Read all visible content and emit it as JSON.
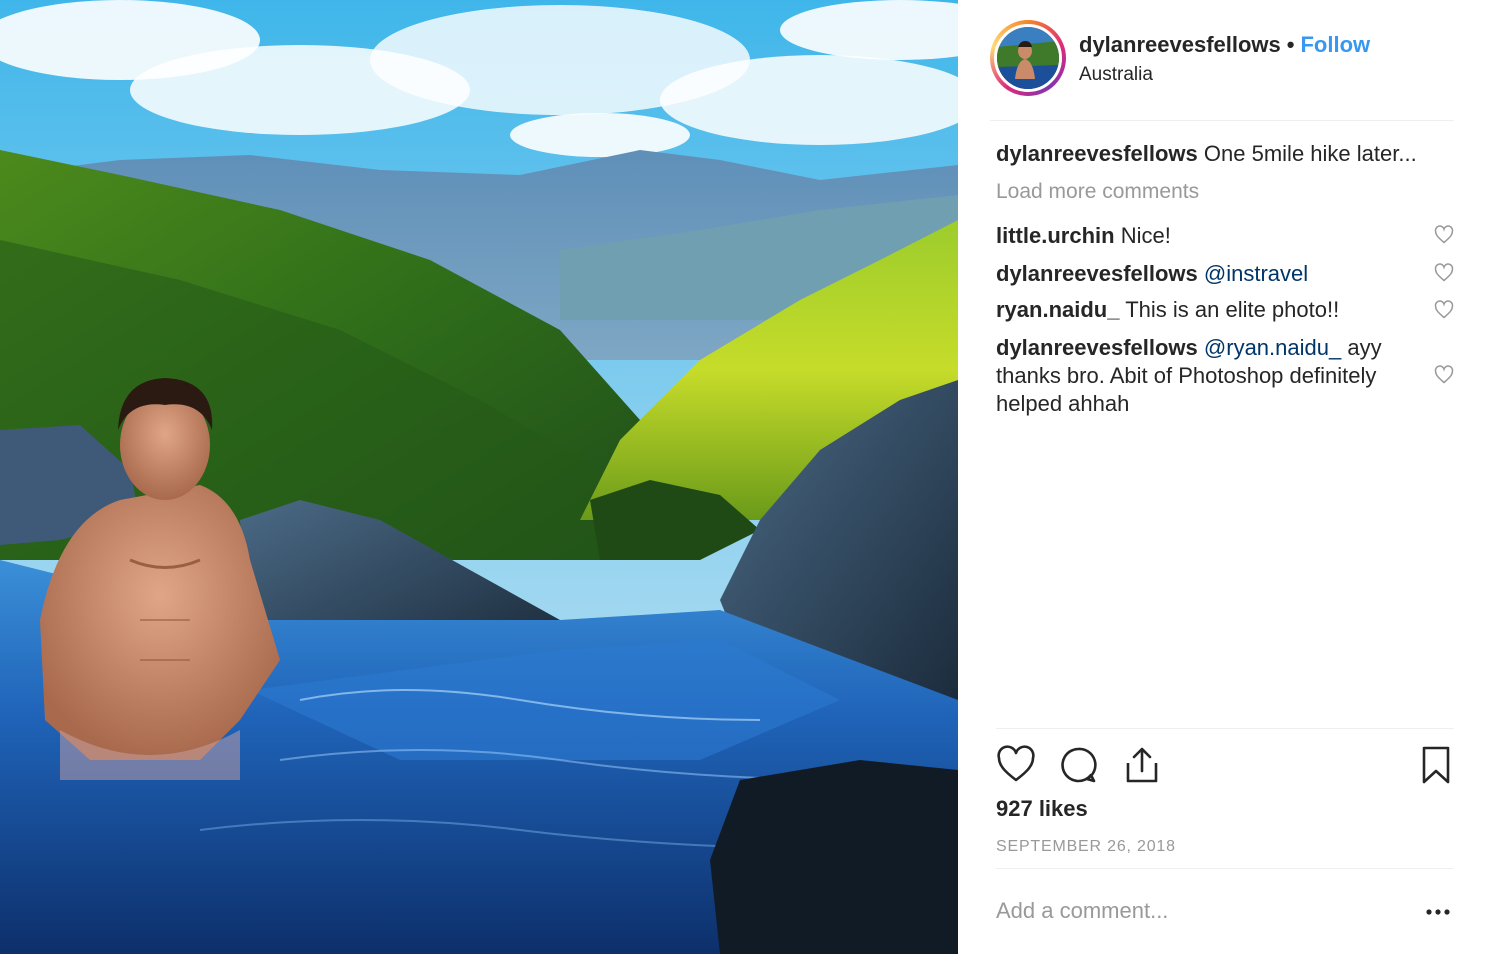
{
  "post": {
    "username": "dylanreevesfellows",
    "separator": "•",
    "follow_label": "Follow",
    "location": "Australia",
    "caption": {
      "user": "dylanreevesfellows",
      "text": "One 5mile hike later..."
    },
    "load_more_label": "Load more comments",
    "comments": [
      {
        "user": "little.urchin",
        "text": "Nice!"
      },
      {
        "user": "dylanreevesfellows",
        "mention": "@instravel",
        "text": ""
      },
      {
        "user": "ryan.naidu_",
        "text": "This is an elite photo!!"
      },
      {
        "user": "dylanreevesfellows",
        "mention": "@ryan.naidu_",
        "text": "ayy thanks bro. Abit of Photoshop definitely helped ahhah"
      }
    ],
    "likes": "927 likes",
    "date": "SEPTEMBER 26, 2018",
    "add_comment_placeholder": "Add a comment..."
  },
  "icons": {
    "like": "heart-icon",
    "comment": "comment-bubble-icon",
    "share": "share-icon",
    "save": "bookmark-icon",
    "more": "more-options-icon",
    "comment_like": "heart-icon"
  },
  "colors": {
    "follow": "#3897f0",
    "mention": "#003569",
    "muted": "#999999",
    "text": "#262626"
  }
}
